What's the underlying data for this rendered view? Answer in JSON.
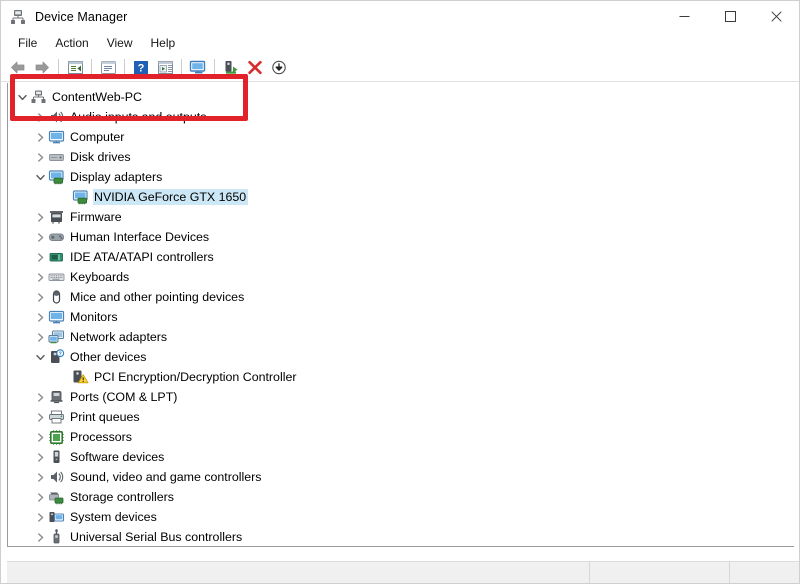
{
  "window": {
    "title": "Device Manager",
    "icon": "device-manager-icon",
    "controls": {
      "minimize": "minimize-icon",
      "maximize": "maximize-icon",
      "close": "close-icon"
    }
  },
  "menu": {
    "items": [
      {
        "label": "File"
      },
      {
        "label": "Action"
      },
      {
        "label": "View"
      },
      {
        "label": "Help"
      }
    ]
  },
  "toolbar": {
    "buttons": [
      {
        "name": "back-button",
        "icon": "arrow-left-icon"
      },
      {
        "name": "forward-button",
        "icon": "arrow-right-icon"
      },
      {
        "name": "separator-1",
        "icon": "separator"
      },
      {
        "name": "show-hide-console-tree-button",
        "icon": "console-tree-icon"
      },
      {
        "name": "separator-2",
        "icon": "separator"
      },
      {
        "name": "properties-button",
        "icon": "properties-icon"
      },
      {
        "name": "separator-3",
        "icon": "separator"
      },
      {
        "name": "help-button",
        "icon": "question-mark-icon"
      },
      {
        "name": "update-driver-button",
        "icon": "update-driver-icon"
      },
      {
        "name": "separator-4",
        "icon": "separator"
      },
      {
        "name": "scan-for-hardware-changes-button",
        "icon": "monitor-scan-icon"
      },
      {
        "name": "separator-5",
        "icon": "separator"
      },
      {
        "name": "enable-device-button",
        "icon": "enable-device-icon"
      },
      {
        "name": "uninstall-device-button",
        "icon": "red-x-icon"
      },
      {
        "name": "install-legacy-hardware-button",
        "icon": "download-arrow-icon"
      }
    ]
  },
  "tree": {
    "root": {
      "label": "ContentWeb-PC",
      "icon": "computer-node-icon",
      "expanded": true,
      "level": 0
    },
    "nodes": [
      {
        "label": "Audio inputs and outputs",
        "icon": "speaker-icon",
        "expanded": false,
        "level": 1,
        "selected": false
      },
      {
        "label": "Computer",
        "icon": "monitor-icon",
        "expanded": false,
        "level": 1,
        "selected": false
      },
      {
        "label": "Disk drives",
        "icon": "disk-drive-icon",
        "expanded": false,
        "level": 1,
        "selected": false
      },
      {
        "label": "Display adapters",
        "icon": "display-adapter-icon",
        "expanded": true,
        "level": 1,
        "selected": false
      },
      {
        "label": "NVIDIA GeForce GTX 1650",
        "icon": "display-adapter-icon",
        "expanded": null,
        "level": 2,
        "selected": true
      },
      {
        "label": "Firmware",
        "icon": "firmware-icon",
        "expanded": false,
        "level": 1,
        "selected": false
      },
      {
        "label": "Human Interface Devices",
        "icon": "hid-icon",
        "expanded": false,
        "level": 1,
        "selected": false
      },
      {
        "label": "IDE ATA/ATAPI controllers",
        "icon": "ide-controller-icon",
        "expanded": false,
        "level": 1,
        "selected": false
      },
      {
        "label": "Keyboards",
        "icon": "keyboard-icon",
        "expanded": false,
        "level": 1,
        "selected": false
      },
      {
        "label": "Mice and other pointing devices",
        "icon": "mouse-icon",
        "expanded": false,
        "level": 1,
        "selected": false
      },
      {
        "label": "Monitors",
        "icon": "monitor-icon",
        "expanded": false,
        "level": 1,
        "selected": false
      },
      {
        "label": "Network adapters",
        "icon": "network-adapter-icon",
        "expanded": false,
        "level": 1,
        "selected": false
      },
      {
        "label": "Other devices",
        "icon": "other-devices-icon",
        "expanded": true,
        "level": 1,
        "selected": false
      },
      {
        "label": "PCI Encryption/Decryption Controller",
        "icon": "unknown-device-warning-icon",
        "expanded": null,
        "level": 2,
        "selected": false
      },
      {
        "label": "Ports (COM & LPT)",
        "icon": "port-icon",
        "expanded": false,
        "level": 1,
        "selected": false
      },
      {
        "label": "Print queues",
        "icon": "printer-icon",
        "expanded": false,
        "level": 1,
        "selected": false
      },
      {
        "label": "Processors",
        "icon": "processor-icon",
        "expanded": false,
        "level": 1,
        "selected": false
      },
      {
        "label": "Software devices",
        "icon": "software-device-icon",
        "expanded": false,
        "level": 1,
        "selected": false
      },
      {
        "label": "Sound, video and game controllers",
        "icon": "speaker-icon",
        "expanded": false,
        "level": 1,
        "selected": false
      },
      {
        "label": "Storage controllers",
        "icon": "storage-controller-icon",
        "expanded": false,
        "level": 1,
        "selected": false
      },
      {
        "label": "System devices",
        "icon": "system-device-icon",
        "expanded": false,
        "level": 1,
        "selected": false
      },
      {
        "label": "Universal Serial Bus controllers",
        "icon": "usb-controller-icon",
        "expanded": false,
        "level": 1,
        "selected": false
      }
    ]
  },
  "annotation": {
    "highlight_color": "#e1222b",
    "target": "Display adapters"
  },
  "colors": {
    "selection": "#cce8f7",
    "annotation_red": "#e1222b",
    "window_bg": "#ffffff",
    "statusbar_bg": "#f0f0f0"
  },
  "statusbar": {
    "panes": [
      "",
      "",
      ""
    ]
  }
}
